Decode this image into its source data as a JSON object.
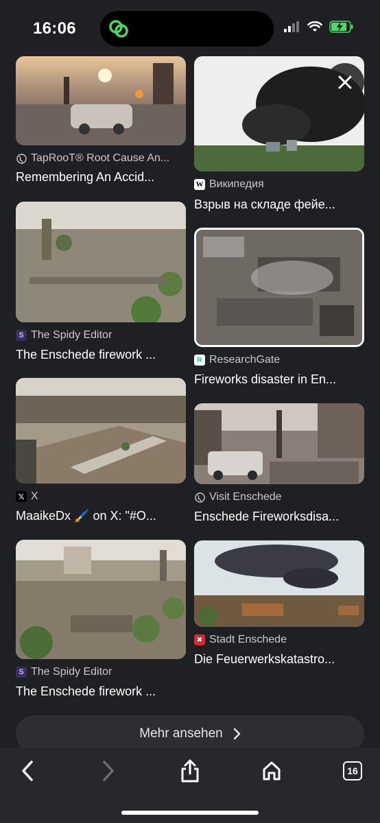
{
  "status": {
    "time": "16:06"
  },
  "results": [
    {
      "source": "TapRooT® Root Cause An...",
      "title": "Remembering An Accid...",
      "fav_icon": "globe-icon"
    },
    {
      "source": "Википедия",
      "title": "Взрыв на складе фейе...",
      "fav_icon": "wikipedia-icon"
    },
    {
      "source": "The Spidy Editor",
      "title": "The Enschede firework ...",
      "fav_icon": "spidy-icon"
    },
    {
      "source": "ResearchGate",
      "title": "Fireworks disaster in En...",
      "fav_icon": "researchgate-icon"
    },
    {
      "source": "X",
      "title": "MaaikeDx 🖌️ on X: \"#O...",
      "fav_icon": "x-icon"
    },
    {
      "source": "Visit Enschede",
      "title": "Enschede Fireworksdisa...",
      "fav_icon": "globe-icon"
    },
    {
      "source": "The Spidy Editor",
      "title": "The Enschede firework ...",
      "fav_icon": "spidy-icon"
    },
    {
      "source": "Stadt Enschede",
      "title": "Die Feuerwerkskatastro...",
      "fav_icon": "stadt-enschede-icon"
    }
  ],
  "more_button": {
    "label": "Mehr ansehen"
  },
  "toolbar": {
    "tab_count": "16"
  },
  "colors": {
    "background": "#1f2023",
    "toolbar": "#27282b",
    "accent_green": "#4cd964"
  }
}
